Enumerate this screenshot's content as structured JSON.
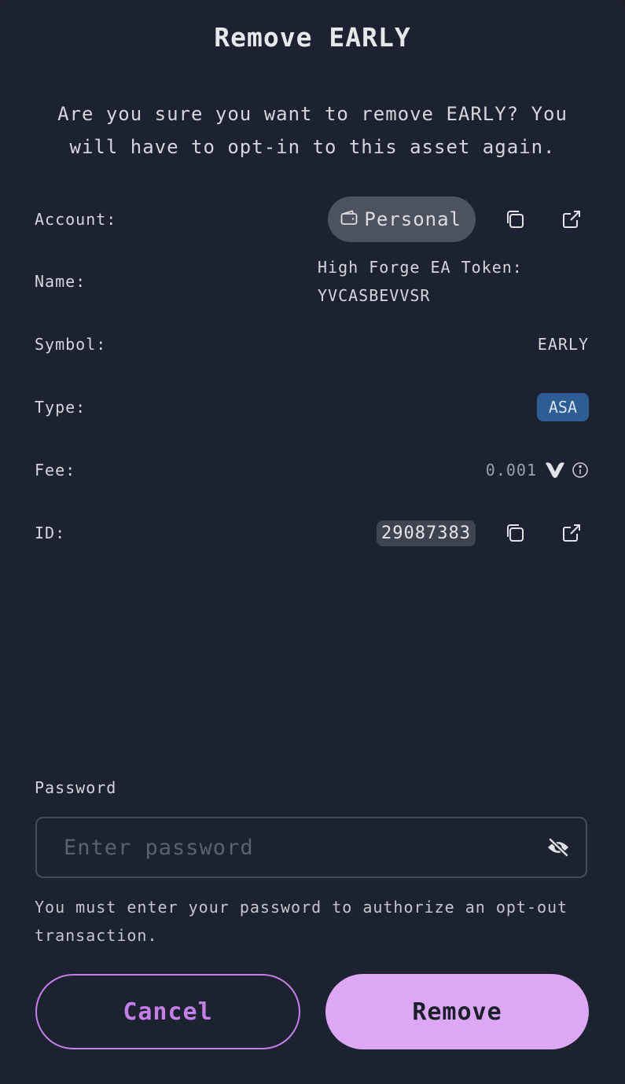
{
  "dialog": {
    "title": "Remove EARLY",
    "description": "Are you sure you want to remove EARLY? You will have to opt-in to this asset again."
  },
  "details": {
    "account": {
      "label": "Account:",
      "value": "Personal",
      "icon": "wallet-icon"
    },
    "name": {
      "label": "Name:",
      "value_line1": "High Forge EA Token:",
      "value_line2": "YVCASBEVVSR"
    },
    "symbol": {
      "label": "Symbol:",
      "value": "EARLY"
    },
    "type": {
      "label": "Type:",
      "value": "ASA",
      "badge_color": "#2d5d93"
    },
    "fee": {
      "label": "Fee:",
      "value": "0.001",
      "currency_icon": "algo-icon",
      "info_icon": "info-icon"
    },
    "id": {
      "label": "ID:",
      "value": "29087383"
    }
  },
  "password": {
    "label": "Password",
    "placeholder": "Enter password",
    "hint": "You must enter your password to authorize an opt-out transaction."
  },
  "actions": {
    "cancel_label": "Cancel",
    "remove_label": "Remove"
  },
  "colors": {
    "background": "#1d2230",
    "accent": "#c47ee8",
    "accent_fill": "#dca8f6"
  }
}
